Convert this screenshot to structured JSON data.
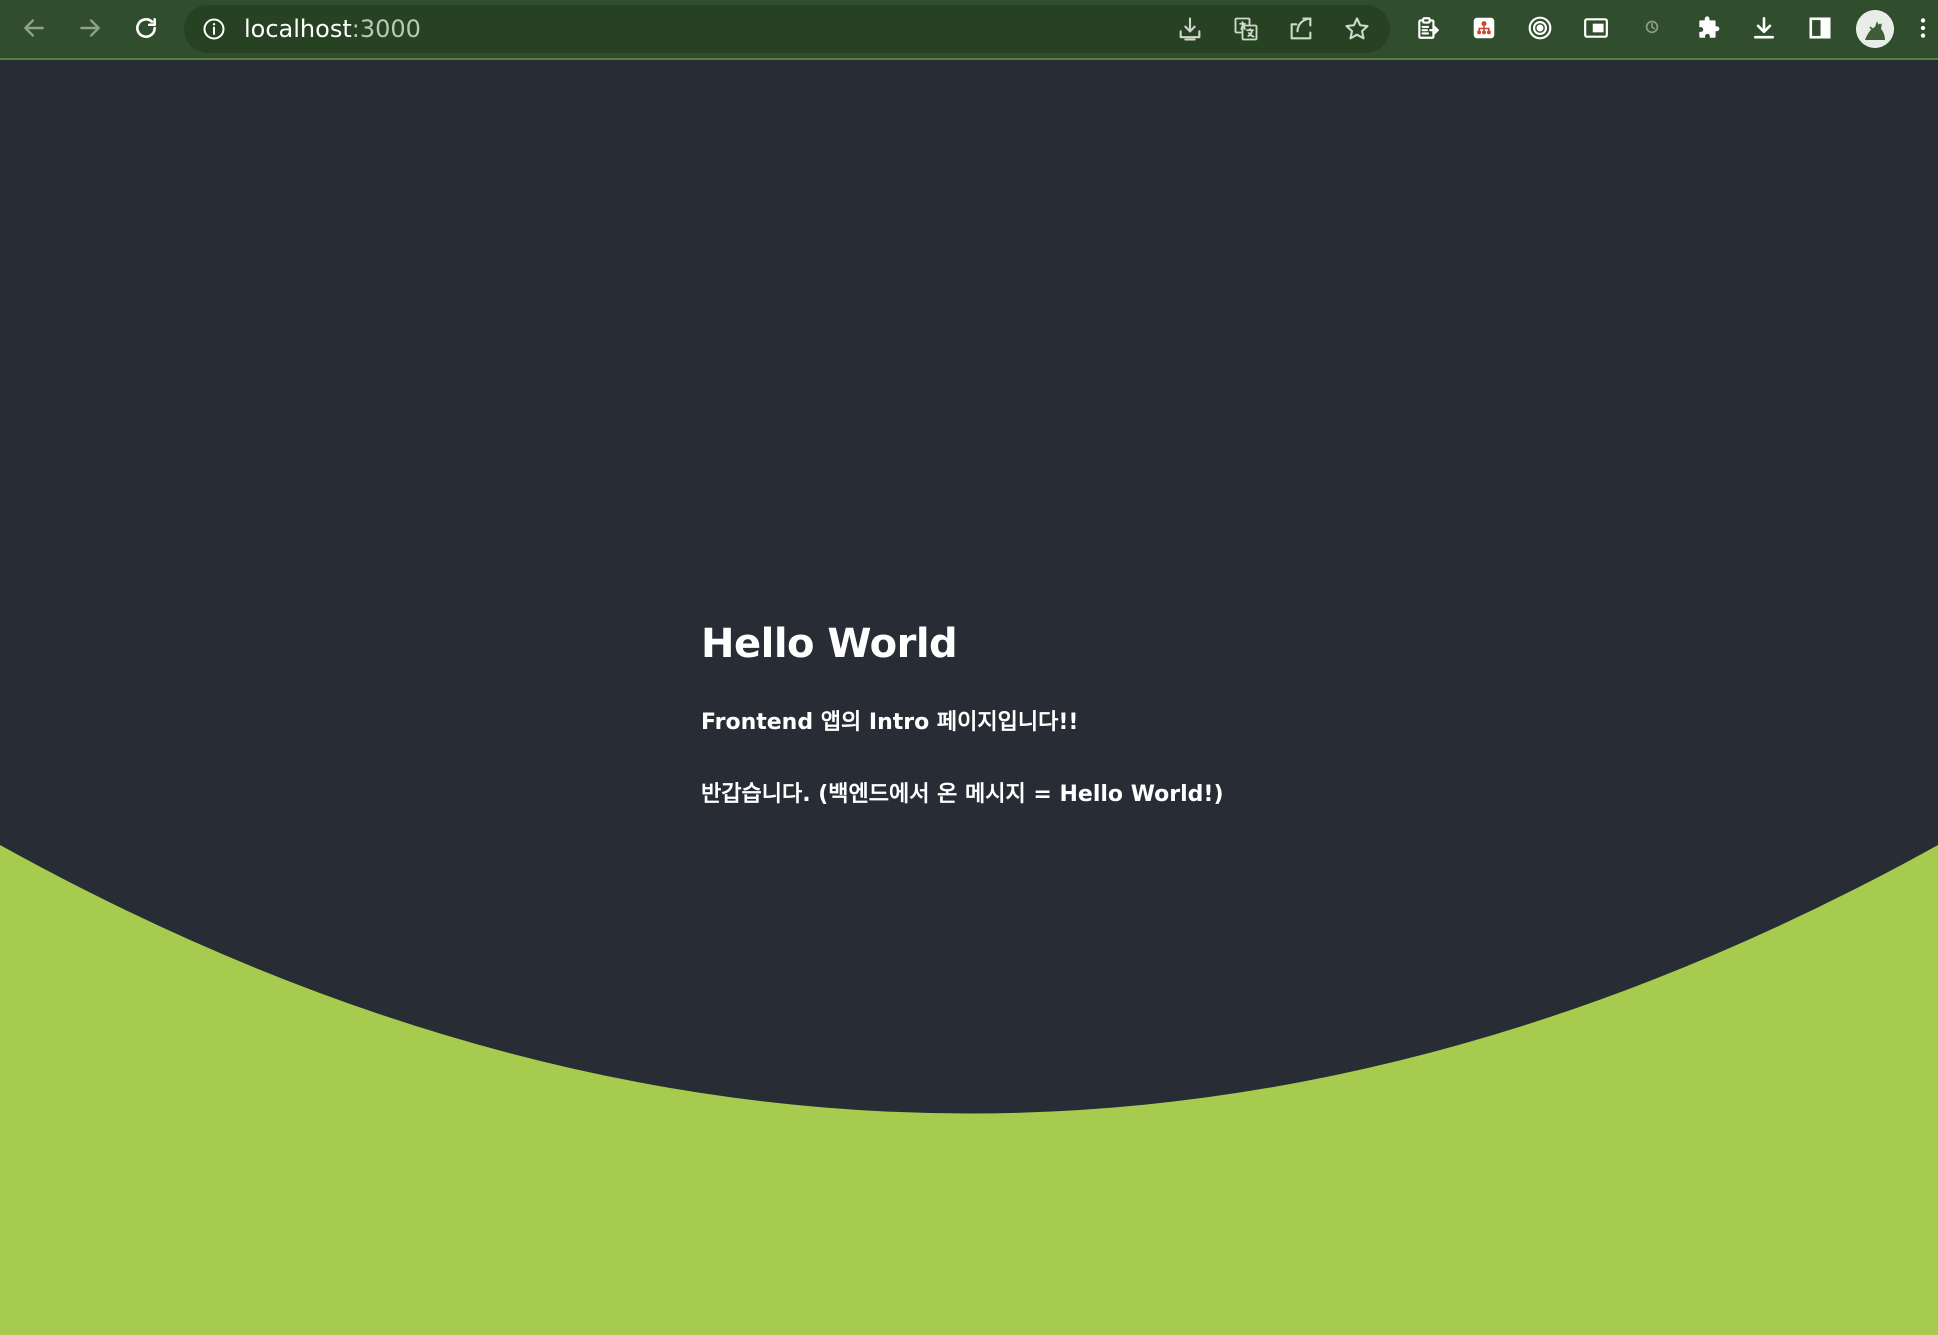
{
  "browser": {
    "url_host": "localhost",
    "url_port": ":3000",
    "icons": {
      "back": "arrow-left-icon",
      "forward": "arrow-right-icon",
      "reload": "reload-icon",
      "site_info": "info-icon",
      "install": "install-app-icon",
      "translate": "translate-icon",
      "share": "share-icon",
      "bookmark": "star-icon",
      "extensions": [
        "clipboard-extension-icon",
        "sitemap-extension-icon",
        "target-extension-icon",
        "picture-in-picture-icon",
        "timer-extension-icon",
        "puzzle-icon"
      ],
      "downloads": "download-icon",
      "side_panel": "side-panel-icon",
      "menu": "kebab-menu-icon"
    }
  },
  "page": {
    "title": "Hello World",
    "intro": "Frontend 앱의 Intro 페이지입니다!!",
    "message": "반갑습니다. (백엔드에서 온 메시지 = Hello World!)"
  },
  "colors": {
    "toolbar": "#304d2e",
    "omnibox": "#264223",
    "background": "#282c34",
    "accent_wave": "#a6cb4f",
    "text": "#ffffff"
  }
}
